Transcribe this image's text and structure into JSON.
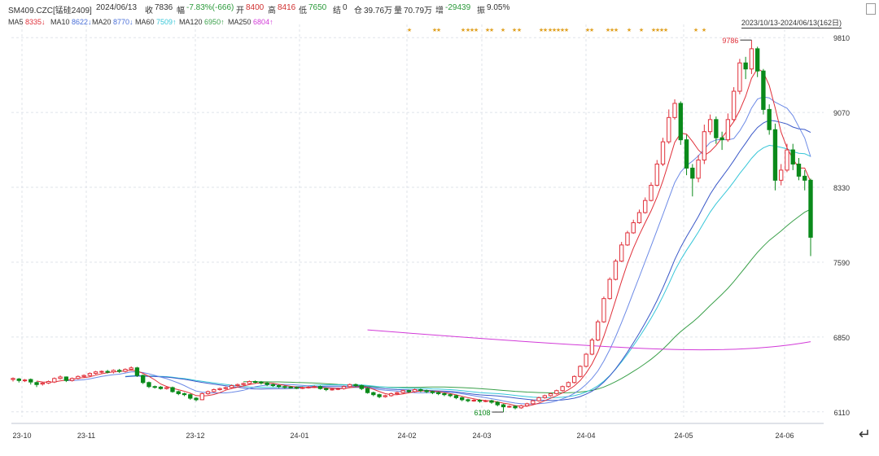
{
  "header": {
    "symbol": "SM409.CZC[锰硅2409]",
    "date": "2024/06/13",
    "close_label": "收",
    "close": "7836",
    "change_label": "幅",
    "change": "-7.83%(-666)",
    "open_label": "开",
    "open": "8400",
    "high_label": "高",
    "high": "8416",
    "low_label": "低",
    "low": "7650",
    "settle_label": "结",
    "settle": "0",
    "oi_label": "仓",
    "oi": "39.76万",
    "vol_label": "量",
    "vol": "70.79万",
    "inc_label": "增",
    "inc": "-29439",
    "amp_label": "振",
    "amp": "9.05%",
    "range": "2023/10/13-2024/06/13(162日)"
  },
  "ma_legend": [
    {
      "label": "MA5",
      "value": "8335↓",
      "color": "#e0303a"
    },
    {
      "label": "MA10",
      "value": "8622↓",
      "color": "#4a6fd8"
    },
    {
      "label": "MA20",
      "value": "8770↓",
      "color": "#4a6fd8"
    },
    {
      "label": "MA60",
      "value": "7509↑",
      "color": "#37c6d8"
    },
    {
      "label": "MA120",
      "value": "6950↑",
      "color": "#3aa04a"
    },
    {
      "label": "MA250",
      "value": "6804↑",
      "color": "#d23ad8"
    }
  ],
  "chart_data": {
    "type": "candlestick",
    "x_ticks": [
      "23-10",
      "23-11",
      "23-12",
      "24-01",
      "24-02",
      "24-03",
      "24-04",
      "24-05",
      "24-06"
    ],
    "y_ticks": [
      9810,
      9070,
      8330,
      7590,
      6850,
      6110
    ],
    "y_range": [
      6060,
      9860
    ],
    "annotations": [
      {
        "text": "9786",
        "value": 9786
      },
      {
        "text": "6108",
        "value": 6108
      }
    ],
    "candles": [
      [
        6430,
        6440,
        6410,
        6450
      ],
      [
        6435,
        6420,
        6400,
        6445
      ],
      [
        6420,
        6425,
        6405,
        6435
      ],
      [
        6430,
        6405,
        6380,
        6440
      ],
      [
        6400,
        6380,
        6355,
        6410
      ],
      [
        6385,
        6395,
        6370,
        6405
      ],
      [
        6395,
        6410,
        6385,
        6420
      ],
      [
        6405,
        6440,
        6395,
        6450
      ],
      [
        6440,
        6455,
        6430,
        6470
      ],
      [
        6455,
        6420,
        6405,
        6460
      ],
      [
        6420,
        6440,
        6410,
        6450
      ],
      [
        6440,
        6460,
        6430,
        6470
      ],
      [
        6460,
        6470,
        6445,
        6480
      ],
      [
        6470,
        6490,
        6460,
        6500
      ],
      [
        6490,
        6505,
        6480,
        6515
      ],
      [
        6505,
        6510,
        6490,
        6520
      ],
      [
        6510,
        6505,
        6490,
        6525
      ],
      [
        6505,
        6520,
        6490,
        6530
      ],
      [
        6520,
        6510,
        6495,
        6535
      ],
      [
        6510,
        6530,
        6500,
        6540
      ],
      [
        6530,
        6545,
        6520,
        6560
      ],
      [
        6545,
        6470,
        6455,
        6555
      ],
      [
        6470,
        6400,
        6385,
        6480
      ],
      [
        6400,
        6360,
        6345,
        6410
      ],
      [
        6360,
        6355,
        6340,
        6370
      ],
      [
        6355,
        6340,
        6330,
        6365
      ],
      [
        6340,
        6350,
        6330,
        6360
      ],
      [
        6350,
        6310,
        6300,
        6360
      ],
      [
        6310,
        6290,
        6275,
        6320
      ],
      [
        6290,
        6280,
        6265,
        6300
      ],
      [
        6280,
        6245,
        6230,
        6290
      ],
      [
        6245,
        6230,
        6215,
        6255
      ],
      [
        6230,
        6290,
        6225,
        6300
      ],
      [
        6290,
        6310,
        6280,
        6320
      ],
      [
        6310,
        6330,
        6300,
        6340
      ],
      [
        6330,
        6340,
        6320,
        6350
      ],
      [
        6340,
        6350,
        6330,
        6360
      ],
      [
        6350,
        6370,
        6340,
        6380
      ],
      [
        6370,
        6380,
        6360,
        6390
      ],
      [
        6380,
        6390,
        6370,
        6400
      ],
      [
        6390,
        6410,
        6380,
        6420
      ],
      [
        6410,
        6405,
        6390,
        6420
      ],
      [
        6405,
        6395,
        6380,
        6415
      ],
      [
        6395,
        6380,
        6365,
        6405
      ],
      [
        6380,
        6370,
        6355,
        6390
      ],
      [
        6370,
        6360,
        6345,
        6380
      ],
      [
        6360,
        6355,
        6340,
        6370
      ],
      [
        6355,
        6350,
        6340,
        6365
      ],
      [
        6350,
        6345,
        6335,
        6360
      ],
      [
        6345,
        6350,
        6335,
        6360
      ],
      [
        6350,
        6355,
        6340,
        6365
      ],
      [
        6355,
        6360,
        6345,
        6370
      ],
      [
        6360,
        6340,
        6330,
        6370
      ],
      [
        6340,
        6330,
        6315,
        6350
      ],
      [
        6330,
        6335,
        6320,
        6345
      ],
      [
        6335,
        6340,
        6325,
        6350
      ],
      [
        6340,
        6360,
        6330,
        6370
      ],
      [
        6360,
        6380,
        6350,
        6390
      ],
      [
        6380,
        6370,
        6355,
        6390
      ],
      [
        6370,
        6340,
        6325,
        6380
      ],
      [
        6340,
        6300,
        6290,
        6350
      ],
      [
        6300,
        6280,
        6265,
        6310
      ],
      [
        6280,
        6260,
        6245,
        6290
      ],
      [
        6260,
        6270,
        6250,
        6280
      ],
      [
        6270,
        6290,
        6260,
        6300
      ],
      [
        6290,
        6300,
        6280,
        6310
      ],
      [
        6300,
        6320,
        6290,
        6330
      ],
      [
        6320,
        6310,
        6300,
        6330
      ],
      [
        6310,
        6330,
        6300,
        6340
      ],
      [
        6330,
        6320,
        6305,
        6340
      ],
      [
        6320,
        6310,
        6295,
        6330
      ],
      [
        6310,
        6300,
        6285,
        6320
      ],
      [
        6300,
        6290,
        6275,
        6310
      ],
      [
        6290,
        6280,
        6265,
        6300
      ],
      [
        6280,
        6270,
        6255,
        6290
      ],
      [
        6270,
        6250,
        6235,
        6280
      ],
      [
        6250,
        6230,
        6215,
        6260
      ],
      [
        6230,
        6220,
        6205,
        6240
      ],
      [
        6220,
        6225,
        6210,
        6235
      ],
      [
        6225,
        6215,
        6200,
        6235
      ],
      [
        6215,
        6220,
        6205,
        6230
      ],
      [
        6220,
        6205,
        6190,
        6230
      ],
      [
        6205,
        6180,
        6165,
        6215
      ],
      [
        6180,
        6160,
        6108,
        6190
      ],
      [
        6160,
        6165,
        6150,
        6175
      ],
      [
        6165,
        6150,
        6135,
        6175
      ],
      [
        6150,
        6170,
        6140,
        6180
      ],
      [
        6170,
        6190,
        6160,
        6200
      ],
      [
        6190,
        6220,
        6180,
        6230
      ],
      [
        6220,
        6250,
        6210,
        6260
      ],
      [
        6250,
        6270,
        6240,
        6280
      ],
      [
        6270,
        6290,
        6260,
        6300
      ],
      [
        6290,
        6320,
        6280,
        6330
      ],
      [
        6320,
        6360,
        6310,
        6370
      ],
      [
        6360,
        6400,
        6350,
        6410
      ],
      [
        6400,
        6460,
        6390,
        6470
      ],
      [
        6460,
        6560,
        6450,
        6570
      ],
      [
        6560,
        6680,
        6550,
        6690
      ],
      [
        6680,
        6820,
        6670,
        6840
      ],
      [
        6820,
        7000,
        6810,
        7020
      ],
      [
        7000,
        7230,
        6990,
        7250
      ],
      [
        7230,
        7420,
        7220,
        7440
      ],
      [
        7420,
        7600,
        7410,
        7620
      ],
      [
        7600,
        7760,
        7590,
        7790
      ],
      [
        7760,
        7880,
        7750,
        7900
      ],
      [
        7880,
        7980,
        7870,
        8010
      ],
      [
        7980,
        8080,
        7970,
        8110
      ],
      [
        8080,
        8200,
        8070,
        8230
      ],
      [
        8200,
        8350,
        8190,
        8380
      ],
      [
        8350,
        8560,
        8340,
        8600
      ],
      [
        8560,
        8780,
        8540,
        8820
      ],
      [
        8780,
        9020,
        8760,
        9100
      ],
      [
        9020,
        9160,
        9000,
        9200
      ],
      [
        9160,
        8800,
        8750,
        9180
      ],
      [
        8800,
        8520,
        8450,
        8850
      ],
      [
        8520,
        8420,
        8240,
        8560
      ],
      [
        8420,
        8600,
        8380,
        8650
      ],
      [
        8600,
        8880,
        8560,
        8950
      ],
      [
        8880,
        9000,
        8850,
        9050
      ],
      [
        9000,
        8820,
        8760,
        9030
      ],
      [
        8820,
        8800,
        8700,
        8880
      ],
      [
        8800,
        9000,
        8780,
        9060
      ],
      [
        9000,
        9280,
        8980,
        9320
      ],
      [
        9280,
        9560,
        9250,
        9600
      ],
      [
        9560,
        9500,
        9400,
        9620
      ],
      [
        9500,
        9700,
        9450,
        9786
      ],
      [
        9700,
        9480,
        9420,
        9720
      ],
      [
        9480,
        9100,
        9050,
        9500
      ],
      [
        9100,
        8900,
        8850,
        9150
      ],
      [
        8900,
        8400,
        8300,
        8960
      ],
      [
        8400,
        8500,
        8350,
        8560
      ],
      [
        8500,
        8700,
        8480,
        8760
      ],
      [
        8700,
        8560,
        8500,
        8760
      ],
      [
        8560,
        8440,
        8400,
        8620
      ],
      [
        8440,
        8400,
        8300,
        8500
      ],
      [
        8400,
        7836,
        7650,
        8416
      ]
    ],
    "ma_lines": {
      "MA5": [],
      "MA250": [
        6920,
        6804
      ]
    },
    "signal_marks": "★"
  }
}
